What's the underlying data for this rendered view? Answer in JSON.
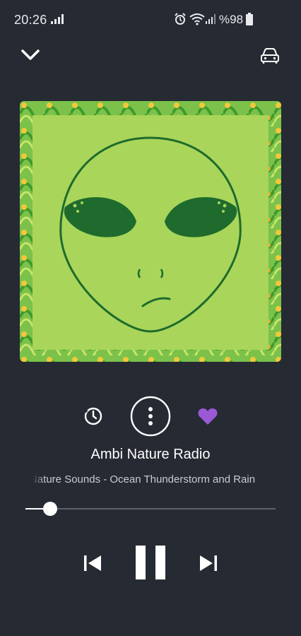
{
  "status_bar": {
    "time": "20:26",
    "battery": "%98",
    "icons": [
      "signal-icon",
      "alarm-icon",
      "wifi-icon",
      "signal-icon",
      "battery-icon"
    ]
  },
  "top_bar": {
    "collapse_icon": "chevron-down-icon",
    "car_mode_icon": "car-icon"
  },
  "now_playing": {
    "station": "Ambi Nature Radio",
    "track": "Nature Sounds - Ocean Thunderstorm and Rain",
    "progress": 0.1
  },
  "actions": {
    "sleep_timer_icon": "timer-icon",
    "more_icon": "more-vertical-icon",
    "favorite_icon": "heart-icon"
  },
  "transport": {
    "previous_icon": "skip-previous-icon",
    "pause_icon": "pause-icon",
    "next_icon": "skip-next-icon"
  },
  "colors": {
    "background": "#262a33",
    "accent_heart": "#9b59d6",
    "art_green": "#a9d55a",
    "alien_dark": "#1e6b2d"
  }
}
